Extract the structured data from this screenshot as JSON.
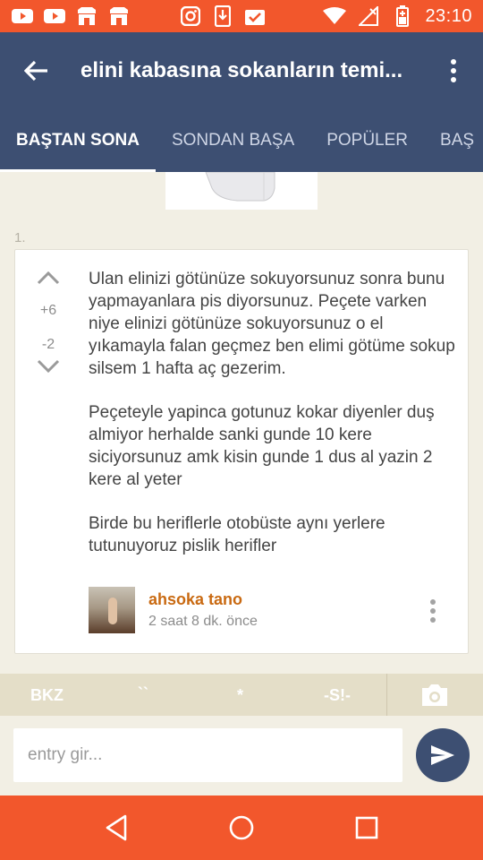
{
  "status_bar": {
    "time": "23:10",
    "left_icons": [
      "youtube-icon",
      "youtube-icon",
      "store-icon",
      "store-icon",
      "instagram-icon",
      "download-icon",
      "check-clipboard-icon"
    ],
    "right_icons": [
      "wifi-icon",
      "signal-icon",
      "battery-icon"
    ]
  },
  "app_bar": {
    "title": "elini kabasına sokanların temi...",
    "tabs": [
      {
        "label": "BAŞTAN SONA",
        "active": true
      },
      {
        "label": "SONDAN BAŞA",
        "active": false
      },
      {
        "label": "POPÜLER",
        "active": false
      },
      {
        "label": "BAŞ",
        "active": false
      }
    ]
  },
  "entry": {
    "number": "1.",
    "upvotes": "+6",
    "downvotes": "-2",
    "paragraphs": [
      "Ulan elinizi götünüze sokuyorsunuz sonra bunu yapmayanlara pis diyorsunuz. Peçete varken niye elinizi götünüze sokuyorsunuz o el yıkamayla falan geçmez ben elimi götüme sokup silsem 1 hafta aç gezerim.",
      "Peçeteyle yapinca gotunuz kokar diyenler duş almiyor herhalde sanki gunde 10 kere siciyorsunuz amk kisin gunde 1 dus al yazin 2 kere al yeter",
      "Birde bu heriflerle otobüste aynı yerlere tutunuyoruz pislik herifler"
    ],
    "author": "ahsoka tano",
    "time": "2 saat 8 dk. önce"
  },
  "toolbar": {
    "bkz": "BKZ",
    "backtick": "``",
    "star": "*",
    "spoiler": "-S!-"
  },
  "input": {
    "placeholder": "entry gir..."
  },
  "colors": {
    "status_bar": "#f2572c",
    "app_bar": "#3d4f72",
    "background": "#f2efe4",
    "author": "#c96a12"
  }
}
